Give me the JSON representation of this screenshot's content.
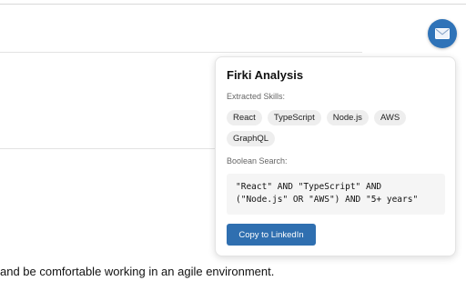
{
  "background": {
    "body_text": "and be comfortable working in an agile environment."
  },
  "fab": {
    "icon": "envelope-icon",
    "color": "#2f73b8"
  },
  "panel": {
    "title": "Firki Analysis",
    "skills_label": "Extracted Skills:",
    "skills": [
      "React",
      "TypeScript",
      "Node.js",
      "AWS",
      "GraphQL"
    ],
    "boolean_label": "Boolean Search:",
    "boolean_query": "\"React\" AND \"TypeScript\" AND\n(\"Node.js\" OR \"AWS\") AND \"5+ years\"",
    "copy_button": "Copy to LinkedIn",
    "accent": "#2f6fb0"
  }
}
